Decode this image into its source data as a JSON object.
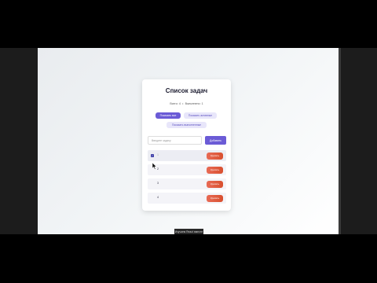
{
  "app": {
    "title": "Список задач",
    "stats": {
      "total_label": "Всего:",
      "total_value": "4",
      "completed_label": "Выполнено:",
      "completed_value": "1"
    },
    "filters": [
      {
        "label": "Показать все",
        "active": true
      },
      {
        "label": "Показать активные",
        "active": false
      },
      {
        "label": "Показать выполненные",
        "active": false
      }
    ],
    "new_task": {
      "placeholder": "Введите задачу",
      "add_label": "Добавить"
    },
    "tasks": [
      {
        "text": "1",
        "done": true,
        "delete_label": "Удалить"
      },
      {
        "text": "2",
        "done": false,
        "delete_label": "Удалить"
      },
      {
        "text": "3",
        "done": false,
        "delete_label": "Удалить"
      },
      {
        "text": "4",
        "done": false,
        "delete_label": "Удалить"
      }
    ]
  },
  "caption": "Изучаем React вместе",
  "colors": {
    "accent": "#6b5bd6",
    "delete": "#d9502f"
  },
  "icons": {
    "checkbox": "check-icon",
    "cursor": "mouse-pointer-icon"
  }
}
